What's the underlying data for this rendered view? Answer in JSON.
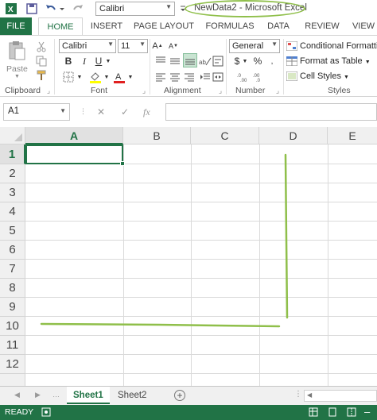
{
  "window": {
    "title": "NewData2 - Microsoft Excel",
    "qat_font": "Calibri"
  },
  "tabs": [
    {
      "id": "file",
      "label": "FILE"
    },
    {
      "id": "home",
      "label": "HOME"
    },
    {
      "id": "insert",
      "label": "INSERT"
    },
    {
      "id": "page_layout",
      "label": "PAGE LAYOUT"
    },
    {
      "id": "formulas",
      "label": "FORMULAS"
    },
    {
      "id": "data",
      "label": "DATA"
    },
    {
      "id": "review",
      "label": "REVIEW"
    },
    {
      "id": "view",
      "label": "VIEW"
    }
  ],
  "ribbon": {
    "clipboard": {
      "label": "Clipboard",
      "paste_label": "Paste"
    },
    "font": {
      "label": "Font",
      "font_name": "Calibri",
      "font_size": "11",
      "bold": "B",
      "italic": "I",
      "underline": "U"
    },
    "alignment": {
      "label": "Alignment"
    },
    "number": {
      "label": "Number",
      "format": "General",
      "currency": "$",
      "percent": "%"
    },
    "styles": {
      "label": "Styles",
      "conditional": "Conditional Formatting",
      "format_table": "Format as Table",
      "cell_styles": "Cell Styles"
    }
  },
  "formula_bar": {
    "name_box": "A1",
    "cancel": "✕",
    "enter": "✓",
    "fx": "fx",
    "value": ""
  },
  "sheet": {
    "columns": [
      "A",
      "B",
      "C",
      "D",
      "E"
    ],
    "rows": [
      "1",
      "2",
      "3",
      "4",
      "5",
      "6",
      "7",
      "8",
      "9",
      "10",
      "11",
      "12"
    ],
    "selected_column": "A",
    "selected_row": "1"
  },
  "sheet_tabs": [
    {
      "label": "Sheet1",
      "active": true
    },
    {
      "label": "Sheet2",
      "active": false
    }
  ],
  "status": {
    "text": "READY"
  },
  "colors": {
    "accent": "#217346",
    "annotation": "#8fbf4a"
  }
}
